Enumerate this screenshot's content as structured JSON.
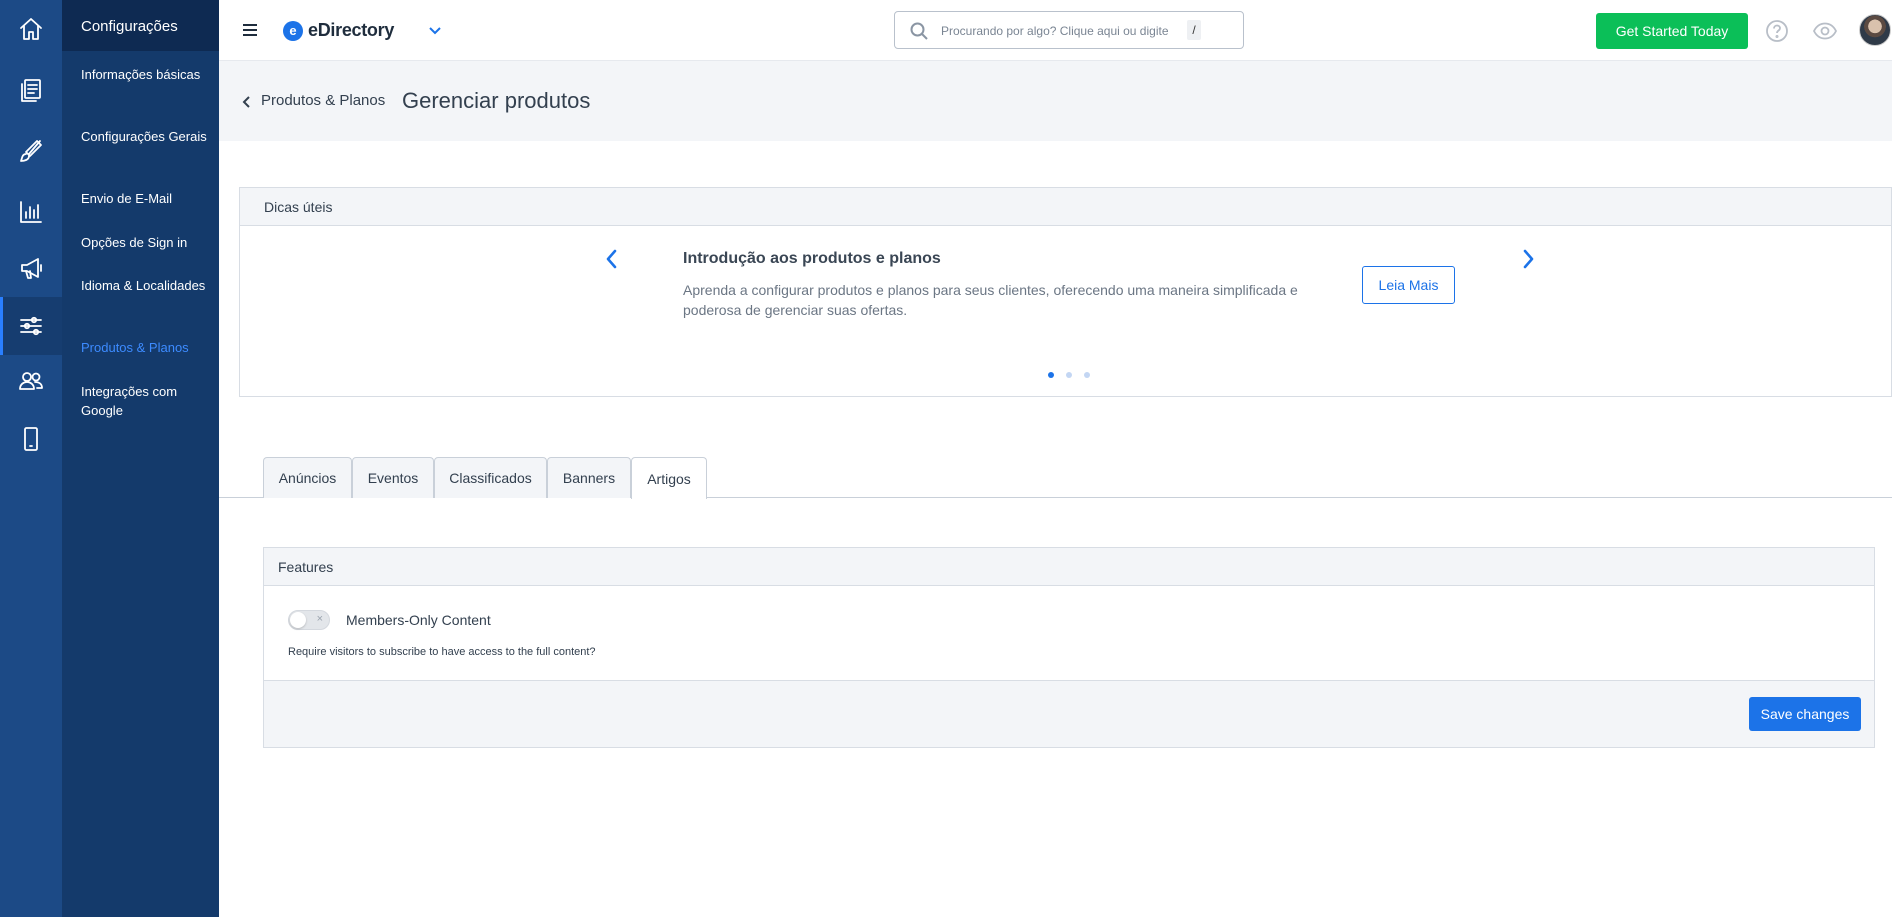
{
  "rail": {
    "items": [
      {
        "icon": "home-icon"
      },
      {
        "icon": "content-icon"
      },
      {
        "icon": "design-brush-icon"
      },
      {
        "icon": "reports-chart-icon"
      },
      {
        "icon": "marketing-megaphone-icon"
      },
      {
        "icon": "settings-sliders-icon",
        "active": true
      },
      {
        "icon": "users-icon"
      },
      {
        "icon": "mobile-icon"
      }
    ]
  },
  "subnav": {
    "title": "Configurações",
    "items": [
      {
        "label": "Informações básicas"
      },
      {
        "label": "Configurações Gerais"
      },
      {
        "label": "Envio de E-Mail"
      },
      {
        "label": "Opções de Sign in"
      },
      {
        "label": "Idioma & Localidades"
      },
      {
        "label": "Produtos & Planos",
        "active": true
      },
      {
        "label": "Integrações com Google"
      }
    ]
  },
  "topbar": {
    "logo_mark": "e",
    "logo_text": "eDirectory",
    "search_placeholder": "Procurando por algo? Clique aqui ou digite",
    "search_shortcut": "/",
    "cta_label": "Get Started Today"
  },
  "header": {
    "breadcrumb": "Produtos & Planos",
    "title": "Gerenciar produtos"
  },
  "tips": {
    "heading": "Dicas úteis",
    "title": "Introdução aos produtos e planos",
    "description": "Aprenda a configurar produtos e planos para seus clientes, oferecendo uma maneira simplificada e poderosa de gerenciar suas ofertas.",
    "button_label": "Leia Mais",
    "slide_count": 3,
    "active_slide": 1
  },
  "tabs": [
    {
      "label": "Anúncios"
    },
    {
      "label": "Eventos"
    },
    {
      "label": "Classificados"
    },
    {
      "label": "Banners"
    },
    {
      "label": "Artigos",
      "active": true
    }
  ],
  "features": {
    "heading": "Features",
    "toggle_label": "Members-Only Content",
    "toggle_state": "off",
    "toggle_off_glyph": "×",
    "description": "Require visitors to subscribe to have access to the full content?",
    "save_label": "Save changes"
  },
  "colors": {
    "rail_bg": "#1c4a86",
    "subnav_bg": "#143a6b",
    "accent": "#1c73e8",
    "cta": "#0bbf58"
  }
}
